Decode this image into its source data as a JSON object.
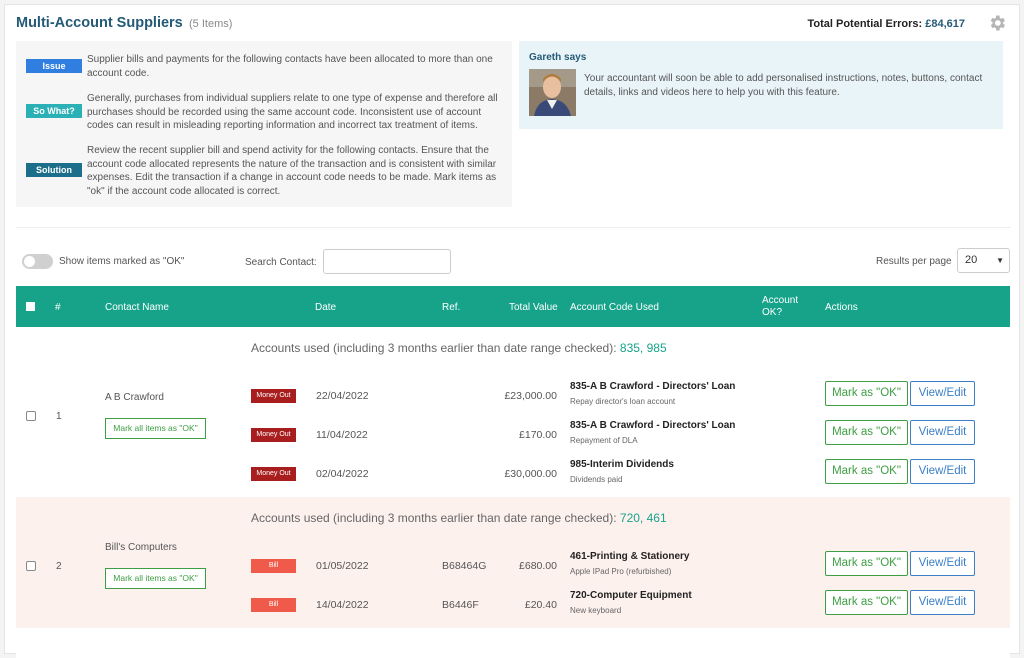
{
  "header": {
    "title": "Multi-Account Suppliers",
    "item_count": "(5 Items)",
    "total_errors_label": "Total Potential Errors:",
    "total_errors_value": "£84,617"
  },
  "info": {
    "issue_label": "Issue",
    "issue_text": "Supplier bills and payments for the following contacts have been allocated to more than one account code.",
    "sowhat_label": "So What?",
    "sowhat_text": "Generally, purchases from individual suppliers relate to one type of expense and therefore all purchases should be recorded using the same account code. Inconsistent use of account codes can result in misleading reporting information and incorrect tax treatment of items.",
    "solution_label": "Solution",
    "solution_text": "Review the recent supplier bill and spend activity for the following contacts. Ensure that the account code allocated represents the nature of the transaction and is consistent with similar expenses. Edit the transaction if a change in account code needs to be made. Mark items as \"ok\" if the account code allocated is correct."
  },
  "advisor": {
    "name": "Gareth says",
    "message": "Your accountant will soon be able to add personalised instructions, notes, buttons, contact details, links and videos here to help you with this feature."
  },
  "filters": {
    "show_ok_label": "Show items marked as \"OK\"",
    "search_label": "Search Contact:",
    "search_value": "",
    "results_per_page_label": "Results per page",
    "results_per_page_value": "20"
  },
  "columns": {
    "num": "#",
    "contact": "Contact Name",
    "date": "Date",
    "ref": "Ref.",
    "total": "Total Value",
    "account_code": "Account Code Used",
    "account_ok_1": "Account",
    "account_ok_2": "OK?",
    "actions": "Actions"
  },
  "labels": {
    "accounts_used_prefix": "Accounts used (including 3 months earlier than date range checked):",
    "mark_all": "Mark all items as \"OK\"",
    "mark_ok": "Mark as \"OK\"",
    "view_edit": "View/Edit"
  },
  "groups": [
    {
      "num": "1",
      "contact": "A B Crawford",
      "codes": "835, 985",
      "items": [
        {
          "type": "Money Out",
          "date": "22/04/2022",
          "ref": "",
          "amount": "£23,000.00",
          "account": "835-A B Crawford - Directors' Loan",
          "desc": "Repay director's loan account"
        },
        {
          "type": "Money Out",
          "date": "11/04/2022",
          "ref": "",
          "amount": "£170.00",
          "account": "835-A B Crawford - Directors' Loan",
          "desc": "Repayment of DLA"
        },
        {
          "type": "Money Out",
          "date": "02/04/2022",
          "ref": "",
          "amount": "£30,000.00",
          "account": "985-Interim Dividends",
          "desc": "Dividends paid"
        }
      ]
    },
    {
      "num": "2",
      "contact": "Bill's Computers",
      "codes": "720, 461",
      "items": [
        {
          "type": "Bill",
          "date": "01/05/2022",
          "ref": "B68464G",
          "amount": "£680.00",
          "account": "461-Printing & Stationery",
          "desc": "Apple IPad Pro (refurbished)"
        },
        {
          "type": "Bill",
          "date": "14/04/2022",
          "ref": "B6446F",
          "amount": "£20.40",
          "account": "720-Computer Equipment",
          "desc": "New keyboard"
        }
      ]
    }
  ],
  "colors": {
    "header_teal": "#17a38a",
    "title_blue": "#245a77",
    "money_out": "#a81d1d",
    "bill": "#ef5a4b",
    "ok_green": "#3e9e43",
    "view_blue": "#3a7fc8"
  }
}
